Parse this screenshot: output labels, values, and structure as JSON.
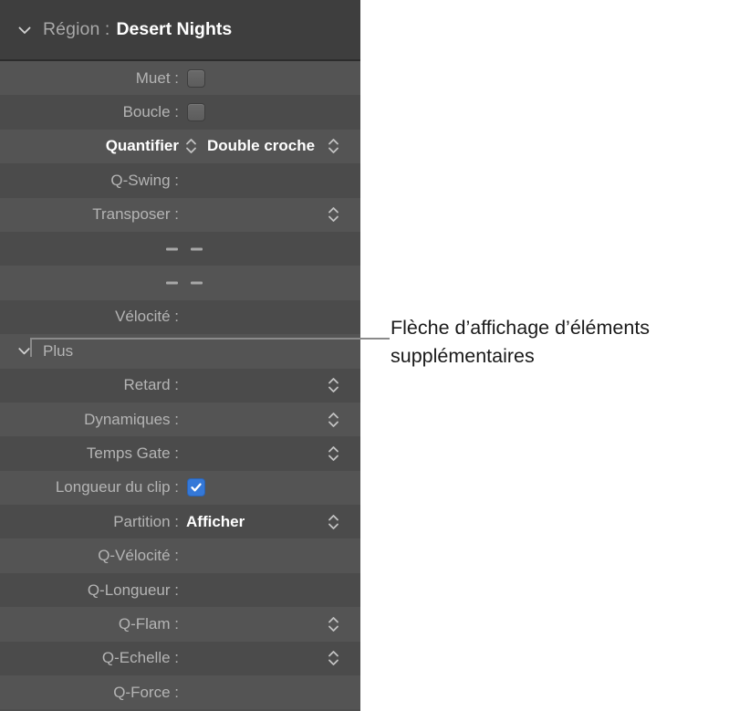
{
  "panel": {
    "header": {
      "disclosure_icon": "chevron-down-icon",
      "label": "Région :",
      "value": "Desert Nights"
    },
    "rows": [
      {
        "label": "Muet :",
        "type": "checkbox",
        "checked": false
      },
      {
        "label": "Boucle :",
        "type": "checkbox",
        "checked": false
      },
      {
        "label": "Quantifier",
        "type": "menu",
        "value": "Double croche",
        "inline_stepper": true,
        "stepper": true,
        "bold_label": true
      },
      {
        "label": "Q-Swing :",
        "type": "empty"
      },
      {
        "label": "Transposer :",
        "type": "stepper",
        "stepper": true
      },
      {
        "label": "",
        "type": "dashes"
      },
      {
        "label": "",
        "type": "dashes"
      },
      {
        "label": "Vélocité :",
        "type": "empty"
      },
      {
        "label": "Plus",
        "type": "disclosure",
        "disclosure_icon": "chevron-down-icon"
      },
      {
        "label": "Retard :",
        "type": "stepper",
        "stepper": true
      },
      {
        "label": "Dynamiques :",
        "type": "stepper",
        "stepper": true
      },
      {
        "label": "Temps Gate :",
        "type": "stepper",
        "stepper": true
      },
      {
        "label": "Longueur du clip :",
        "type": "checkbox",
        "checked": true
      },
      {
        "label": "Partition :",
        "type": "menu",
        "value": "Afficher",
        "stepper": true
      },
      {
        "label": "Q-Vélocité :",
        "type": "empty"
      },
      {
        "label": "Q-Longueur :",
        "type": "empty"
      },
      {
        "label": "Q-Flam :",
        "type": "stepper",
        "stepper": true
      },
      {
        "label": "Q-Echelle :",
        "type": "stepper",
        "stepper": true
      },
      {
        "label": "Q-Force :",
        "type": "empty"
      }
    ]
  },
  "annotation": {
    "text": "Flèche d’affichage d’éléments supplémentaires",
    "line_color": "#8a8a8a"
  },
  "colors": {
    "panel_background": "#4e4e4e",
    "header_background": "#3e3e3e",
    "row_odd": "#545454",
    "row_even": "#4b4b4b",
    "label_text": "#b4b4b4",
    "value_text": "#ffffff",
    "checkbox_on": "#3478d8",
    "annotation_text": "#1a1a1a"
  }
}
